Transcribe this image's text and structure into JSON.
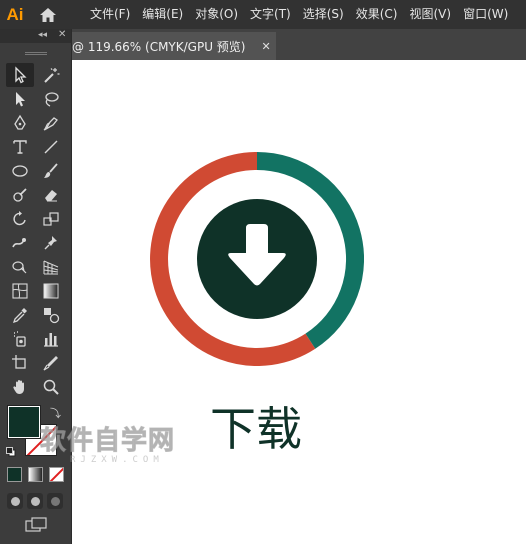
{
  "app": {
    "logo": "Ai"
  },
  "menu": {
    "items": [
      "文件(F)",
      "编辑(E)",
      "对象(O)",
      "文字(T)",
      "选择(S)",
      "效果(C)",
      "视图(V)",
      "窗口(W)"
    ]
  },
  "panel": {
    "collapse_glyph": "◂◂",
    "close_glyph": "✕"
  },
  "tools": [
    {
      "left": "selection-tool-icon",
      "right": "magic-wand-tool-icon"
    },
    {
      "left": "direct-selection-tool-icon",
      "right": "lasso-tool-icon"
    },
    {
      "left": "pen-tool-icon",
      "right": "curvature-tool-icon"
    },
    {
      "left": "type-tool-icon",
      "right": "line-segment-tool-icon"
    },
    {
      "left": "ellipse-tool-icon",
      "right": "paintbrush-tool-icon"
    },
    {
      "left": "shaper-tool-icon",
      "right": "eraser-tool-icon"
    },
    {
      "left": "rotate-tool-icon",
      "right": "scale-tool-icon"
    },
    {
      "left": "width-tool-icon",
      "right": "puppet-warp-tool-icon"
    },
    {
      "left": "shape-builder-tool-icon",
      "right": "perspective-grid-tool-icon"
    },
    {
      "left": "mesh-tool-icon",
      "right": "gradient-tool-icon"
    },
    {
      "left": "eyedropper-tool-icon",
      "right": "blend-tool-icon"
    },
    {
      "left": "symbol-sprayer-tool-icon",
      "right": "column-graph-tool-icon"
    },
    {
      "left": "artboard-tool-icon",
      "right": "slice-tool-icon"
    },
    {
      "left": "hand-tool-icon",
      "right": "zoom-tool-icon"
    }
  ],
  "colors": {
    "fill": "#0f3228",
    "stroke": "none",
    "ring_left": "#d04a33",
    "ring_right": "#127363",
    "inner_circle": "#0f3228",
    "arrow": "#ffffff"
  },
  "document_tab": {
    "title": "@ 119.66% (CMYK/GPU 预览)",
    "close_glyph": "✕"
  },
  "canvas": {
    "artwork_label": "下载",
    "watermark_main": "软件自学网",
    "watermark_sub": "RJZXW.COM"
  }
}
